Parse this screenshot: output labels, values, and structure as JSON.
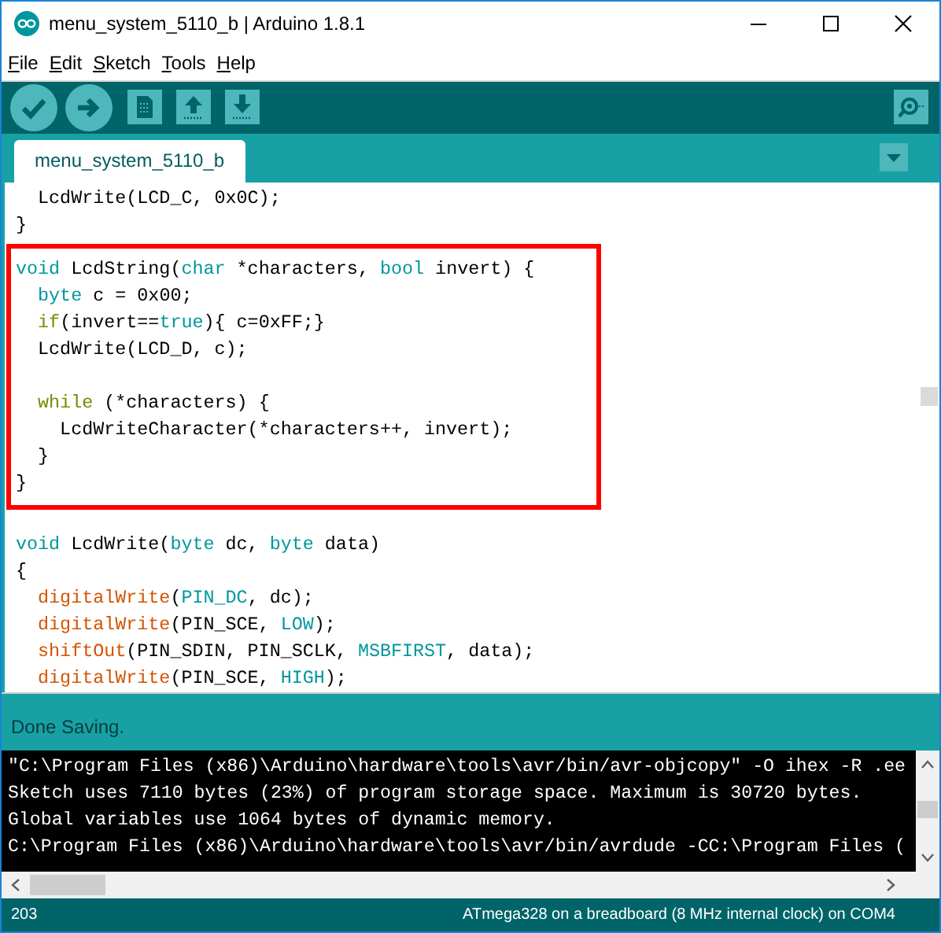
{
  "window": {
    "title": "menu_system_5110_b | Arduino 1.8.1"
  },
  "menu": [
    {
      "label": "File"
    },
    {
      "label": "Edit"
    },
    {
      "label": "Sketch"
    },
    {
      "label": "Tools"
    },
    {
      "label": "Help"
    }
  ],
  "tabs": [
    {
      "label": "menu_system_5110_b",
      "selected": true
    }
  ],
  "editor": {
    "sections": [
      {
        "highlighted": false,
        "lines": [
          {
            "tokens": [
              {
                "text": "  LcdWrite(LCD_C, 0x0C);",
                "kind": "plain"
              }
            ]
          },
          {
            "tokens": [
              {
                "text": "}",
                "kind": "plain"
              }
            ]
          }
        ]
      },
      {
        "highlighted": true,
        "lines": [
          {
            "tokens": [
              {
                "text": "void",
                "kind": "type"
              },
              {
                "text": " LcdString(",
                "kind": "plain"
              },
              {
                "text": "char",
                "kind": "type"
              },
              {
                "text": " *characters, ",
                "kind": "plain"
              },
              {
                "text": "bool",
                "kind": "type"
              },
              {
                "text": " invert) {",
                "kind": "plain"
              }
            ]
          },
          {
            "tokens": [
              {
                "text": "  byte",
                "kind": "type"
              },
              {
                "text": " c = 0x00;",
                "kind": "plain"
              }
            ]
          },
          {
            "tokens": [
              {
                "text": "  if",
                "kind": "control"
              },
              {
                "text": "(invert==",
                "kind": "plain"
              },
              {
                "text": "true",
                "kind": "type"
              },
              {
                "text": "){ c=0xFF;}",
                "kind": "plain"
              }
            ]
          },
          {
            "tokens": [
              {
                "text": "  LcdWrite(LCD_D, c);",
                "kind": "plain"
              }
            ]
          },
          {
            "blank": true
          },
          {
            "tokens": [
              {
                "text": "  while",
                "kind": "control"
              },
              {
                "text": " (*characters) {",
                "kind": "plain"
              }
            ]
          },
          {
            "tokens": [
              {
                "text": "    LcdWriteCharacter(*characters++, invert);",
                "kind": "plain"
              }
            ]
          },
          {
            "tokens": [
              {
                "text": "  }",
                "kind": "plain"
              }
            ]
          },
          {
            "tokens": [
              {
                "text": "}",
                "kind": "plain"
              }
            ]
          }
        ]
      },
      {
        "highlighted": false,
        "lines": [
          {
            "tokens": [
              {
                "text": "void",
                "kind": "type"
              },
              {
                "text": " LcdWrite(",
                "kind": "plain"
              },
              {
                "text": "byte",
                "kind": "type"
              },
              {
                "text": " dc, ",
                "kind": "plain"
              },
              {
                "text": "byte",
                "kind": "type"
              },
              {
                "text": " data)",
                "kind": "plain"
              }
            ]
          },
          {
            "tokens": [
              {
                "text": "{",
                "kind": "plain"
              }
            ]
          },
          {
            "tokens": [
              {
                "text": "  digitalWrite",
                "kind": "function"
              },
              {
                "text": "(",
                "kind": "plain"
              },
              {
                "text": "PIN_DC",
                "kind": "type"
              },
              {
                "text": ", dc);",
                "kind": "plain"
              }
            ]
          },
          {
            "tokens": [
              {
                "text": "  digitalWrite",
                "kind": "function"
              },
              {
                "text": "(PIN_SCE, ",
                "kind": "plain"
              },
              {
                "text": "LOW",
                "kind": "type"
              },
              {
                "text": ");",
                "kind": "plain"
              }
            ]
          },
          {
            "tokens": [
              {
                "text": "  shiftOut",
                "kind": "function"
              },
              {
                "text": "(PIN_SDIN, PIN_SCLK, ",
                "kind": "plain"
              },
              {
                "text": "MSBFIRST",
                "kind": "type"
              },
              {
                "text": ", data);",
                "kind": "plain"
              }
            ]
          },
          {
            "tokens": [
              {
                "text": "  digitalWrite",
                "kind": "function"
              },
              {
                "text": "(PIN_SCE, ",
                "kind": "plain"
              },
              {
                "text": "HIGH",
                "kind": "type"
              },
              {
                "text": ");",
                "kind": "plain"
              }
            ]
          }
        ]
      }
    ]
  },
  "status": {
    "message": "Done Saving."
  },
  "console": {
    "lines": [
      "\"C:\\Program Files (x86)\\Arduino\\hardware\\tools\\avr/bin/avr-objcopy\" -O ihex -R .ee",
      "Sketch uses 7110 bytes (23%) of program storage space. Maximum is 30720 bytes.",
      "Global variables use 1064 bytes of dynamic memory.",
      "C:\\Program Files (x86)\\Arduino\\hardware\\tools\\avr/bin/avrdude -CC:\\Program Files ("
    ]
  },
  "footer": {
    "line": "203",
    "board": "ATmega328 on a breadboard (8 MHz internal clock) on COM4"
  }
}
